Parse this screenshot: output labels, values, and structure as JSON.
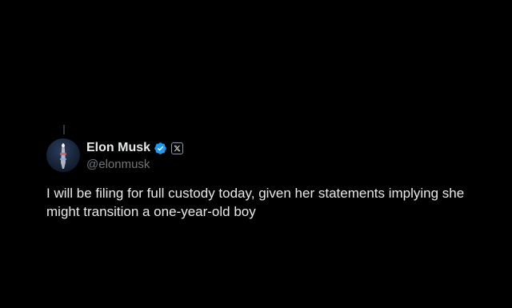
{
  "tweet": {
    "author": {
      "display_name": "Elon Musk",
      "handle": "@elonmusk",
      "verified": true,
      "affiliation_badge": "x-logo-icon"
    },
    "text": "I will be filing for full custody today, given her statements implying she might transition a one-year-old boy"
  },
  "theme": {
    "background": "#000000",
    "text_primary": "#e7e9ea",
    "text_secondary": "#71767b",
    "verified_blue": "#1d9bf0"
  }
}
